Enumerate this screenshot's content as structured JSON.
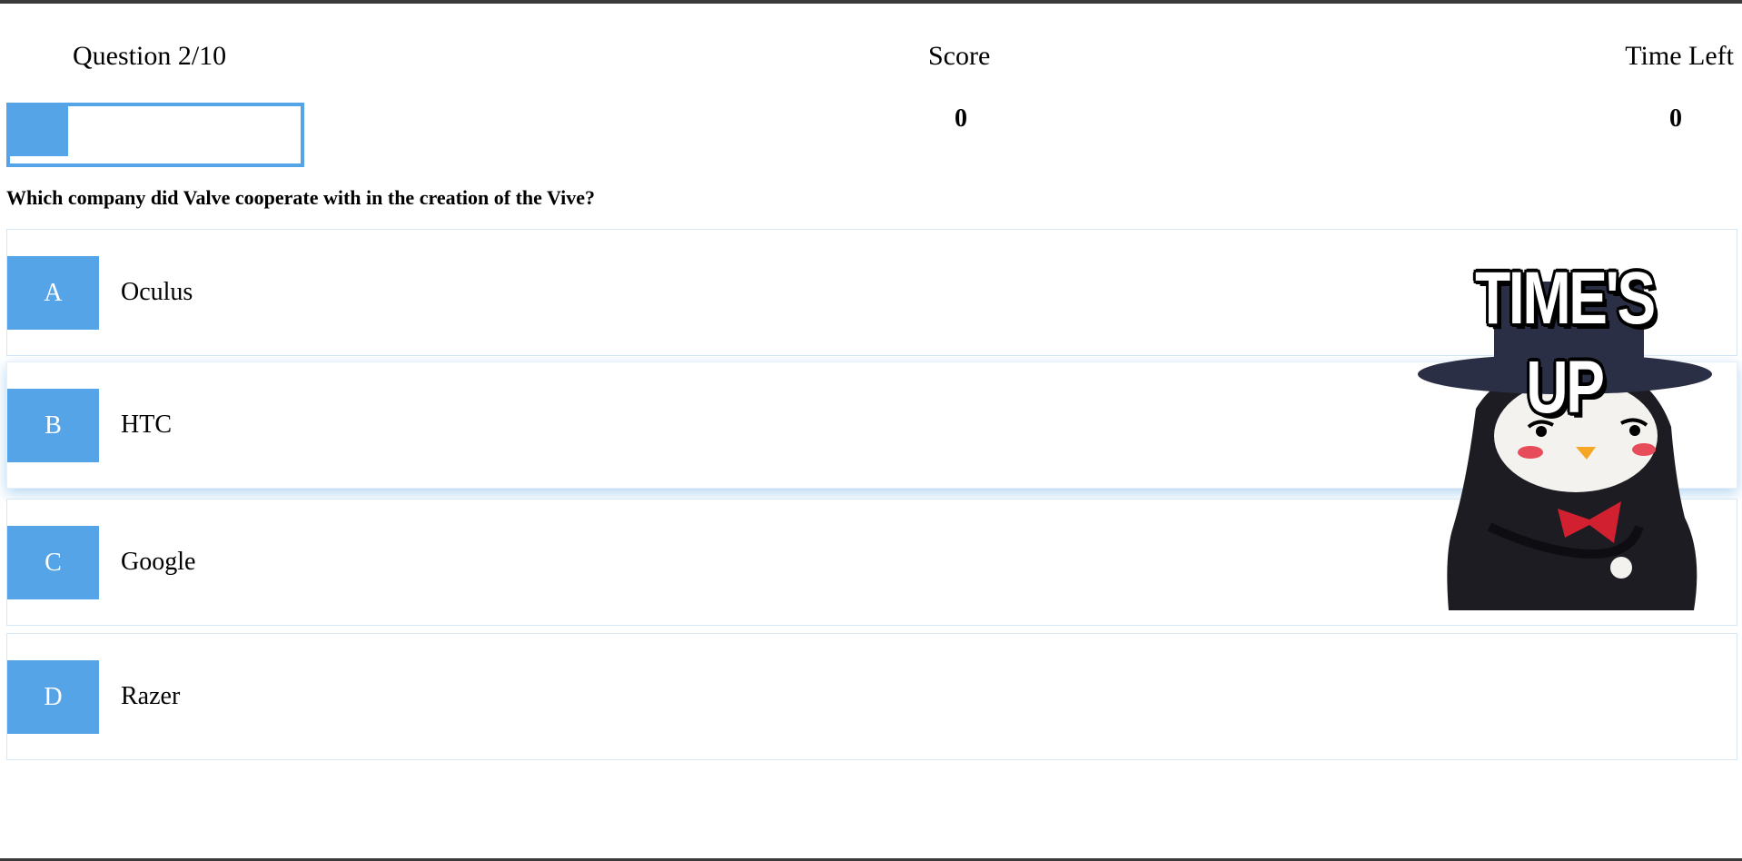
{
  "header": {
    "question_label": "Question 2/10",
    "score_label": "Score",
    "score_value": "0",
    "time_label": "Time Left",
    "time_value": "0"
  },
  "progress": {
    "fraction": 0.2
  },
  "question": "Which company did Valve cooperate with in the creation of the Vive?",
  "options": [
    {
      "letter": "A",
      "text": "Oculus"
    },
    {
      "letter": "B",
      "text": "HTC"
    },
    {
      "letter": "C",
      "text": "Google"
    },
    {
      "letter": "D",
      "text": "Razer"
    }
  ],
  "gif": {
    "title": "TIME'S UP",
    "icon": "penguin-top-hat-icon"
  },
  "colors": {
    "accent": "#56a4e8",
    "text": "#000000",
    "border": "#d6e7f6"
  }
}
